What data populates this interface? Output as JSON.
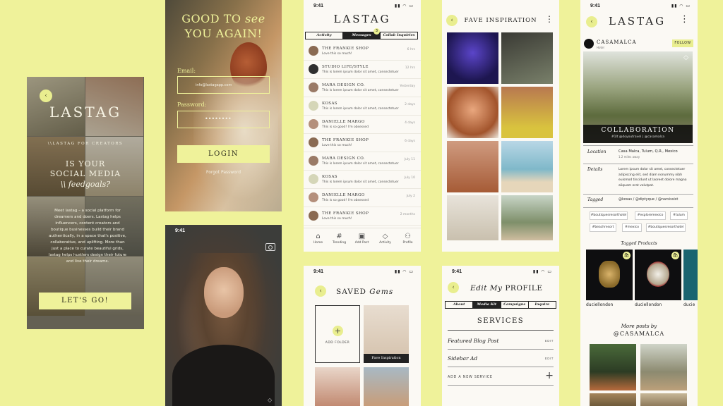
{
  "colors": {
    "background": "#eff29a",
    "accent": "#e9ee8f",
    "dark": "#222222",
    "panel": "#fbf9f4"
  },
  "onboarding": {
    "logo": "LASTAG",
    "for_creators": "\\\\LASTAG FOR CREATORS",
    "headline_1": "IS YOUR",
    "headline_2": "SOCIAL MEDIA",
    "headline_3": "\\\\ feedgoals?",
    "body": "Meet lastag – a social platform for dreamers and doers. Lastag helps influencers, content creators and boutique businesses build their brand authentically, in a space that's positive, collaborative, and uplifting. More than just a place to curate beautiful grids, lastag helps hustlers design their future and live their dreams.",
    "cta": "LET'S GO!"
  },
  "login": {
    "greeting_1": "GOOD TO",
    "greeting_see": "see",
    "greeting_2": "YOU AGAIN!",
    "email_label": "Email:",
    "email_value": "info@lastagapp.com",
    "password_label": "Password:",
    "password_value": "••••••••",
    "login_button": "LOGIN",
    "forgot": "Forgot Password"
  },
  "camera": {
    "time": "9:41",
    "camera_icon": "camera-icon"
  },
  "messages": {
    "time": "9:41",
    "logo": "LASTAG",
    "tabs": [
      "Activity",
      "Messages",
      "Collab Inquiries"
    ],
    "badge": "3",
    "items": [
      {
        "name": "THE FRANKIE SHOP",
        "preview": "Love this so much!",
        "time": "6 hrs"
      },
      {
        "name": "STUDIO LIFE/STYLE",
        "preview": "This is lorem ipsum dolor sit amet, consectetuer",
        "time": "12 hrs"
      },
      {
        "name": "MARA DESIGN CO.",
        "preview": "This is lorem ipsum dolor sit amet, consectetuer",
        "time": "Yesterday"
      },
      {
        "name": "KOSAS",
        "preview": "This is lorem ipsum dolor sit amet, consectetuer",
        "time": "2 days"
      },
      {
        "name": "DANIELLE MARGO",
        "preview": "This is so good! I'm obsessed",
        "time": "4 days"
      },
      {
        "name": "THE FRANKIE SHOP",
        "preview": "Love this so much!",
        "time": "6 days"
      },
      {
        "name": "MARA DESIGN CO.",
        "preview": "This is lorem ipsum dolor sit amet, consectetuer",
        "time": "July 11"
      },
      {
        "name": "KOSAS",
        "preview": "This is lorem ipsum dolor sit amet, consectetuer",
        "time": "July 10"
      },
      {
        "name": "DANIELLE MARGO",
        "preview": "This is so good! I'm obsessed",
        "time": "July 2"
      },
      {
        "name": "THE FRANKIE SHOP",
        "preview": "Love this so much!",
        "time": "2 months"
      }
    ],
    "nav": [
      "Home",
      "Trending",
      "Add Post",
      "Activity",
      "Profile"
    ]
  },
  "fave": {
    "title": "FAVE INSPIRATION"
  },
  "saved": {
    "time": "9:41",
    "title_1": "SAVED",
    "title_2": "Gems",
    "add_folder": "ADD FOLDER",
    "folder_label": "Fave Inspiration"
  },
  "profile": {
    "time": "9:41",
    "title_1": "Edit My",
    "title_2": "PROFILE",
    "tabs": [
      "About",
      "Media Kit",
      "Campaigns",
      "Inquire"
    ],
    "services_heading": "SERVICES",
    "services": [
      {
        "name": "Featured Blog Post",
        "action": "EDIT"
      },
      {
        "name": "Sidebar Ad",
        "action": "EDIT"
      }
    ],
    "add_service": "ADD A NEW SERVICE"
  },
  "collab": {
    "time": "9:41",
    "logo": "LASTAG",
    "account": "CASAMALCA",
    "account_sub": "Hotel",
    "follow": "FOLLOW",
    "banner_title": "COLLABORATION",
    "banner_sub": "#1lt @doyoutravel | @casamalca",
    "location_label": "Location",
    "location_value": "Casa Malca, Tulum, Q.R., Mexico",
    "location_dist": "1.2 miles away",
    "details_label": "Details",
    "details_value": "Lorem ipsum dolor sit amet, consectetuer adipiscing elit, sed diam nonummy nibh euismod tincidunt ut laoreet dolore magna aliquam erat volutpat.",
    "tagged_label": "Tagged",
    "tagged_value": "@kosas / @diptyque / @narsissist",
    "hashtags": [
      "#boutiquesresorthotel",
      "#exploremexico",
      "#tulum",
      "#beachresort",
      "#mexico",
      "#boutiquesresorthotel"
    ],
    "tagged_products": "Tagged Products",
    "products": [
      "duciellondon",
      "duciellondon",
      "ducie"
    ],
    "more_posts_1": "More posts by",
    "more_posts_2": "@CASAMALCA"
  }
}
